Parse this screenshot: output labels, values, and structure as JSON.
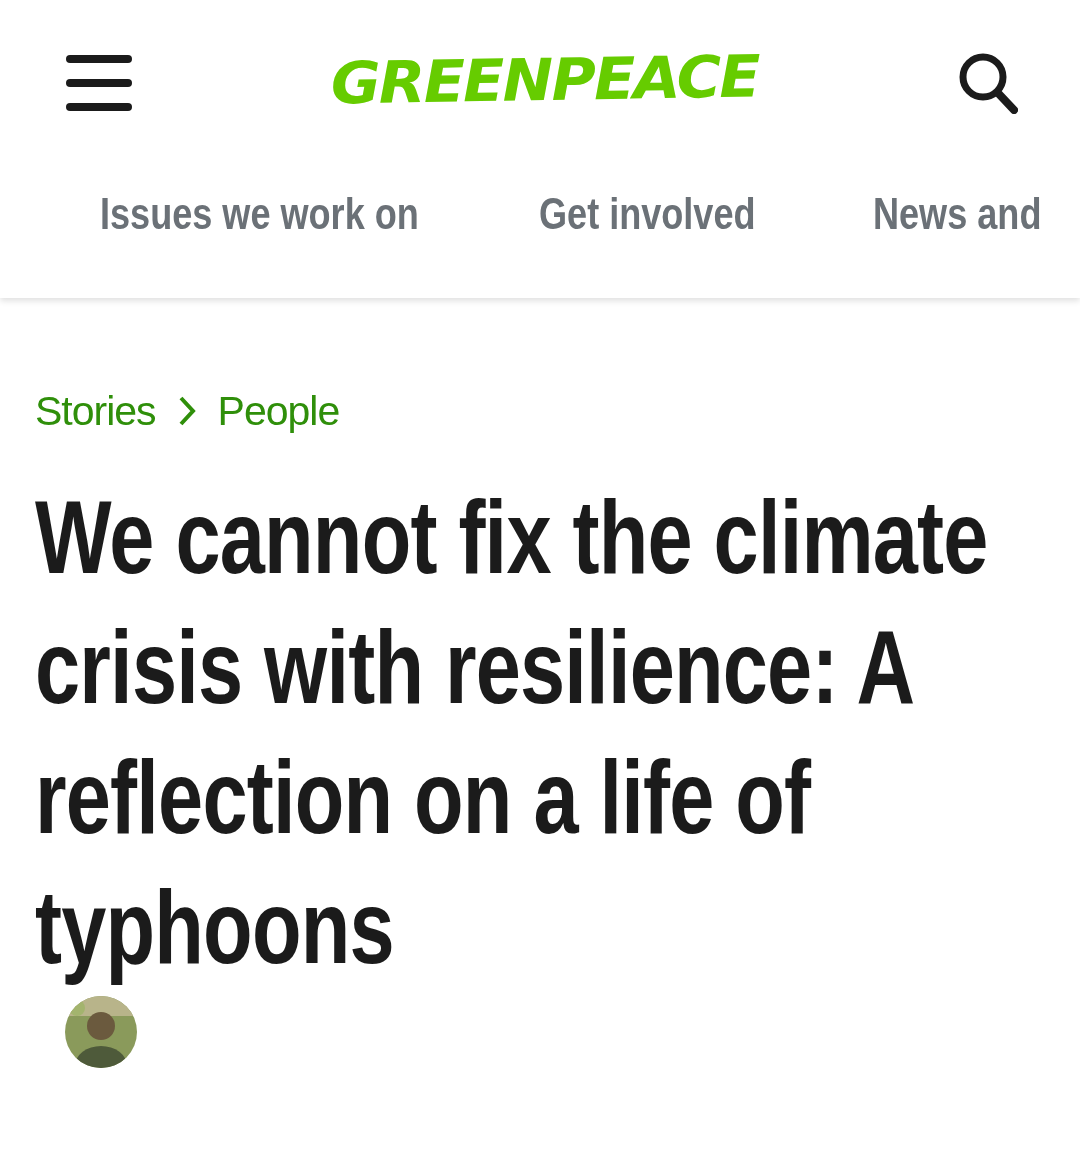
{
  "header": {
    "logo": "GREENPEACE"
  },
  "nav": [
    {
      "label": "Issues we work on"
    },
    {
      "label": "Get involved"
    },
    {
      "label": "News and"
    }
  ],
  "breadcrumb": [
    "Stories",
    "People"
  ],
  "article": {
    "title": "We cannot fix the climate crisis with resilience: A reflection on a life of typhoons"
  }
}
